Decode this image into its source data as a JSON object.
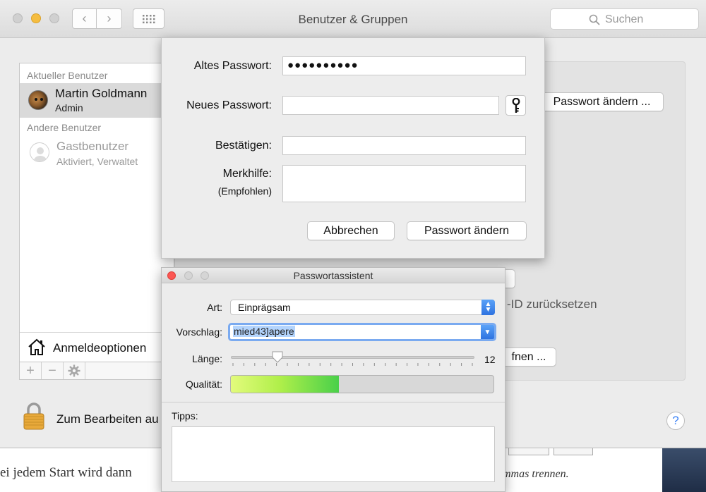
{
  "window": {
    "title": "Benutzer & Gruppen",
    "search_placeholder": "Suchen"
  },
  "sidebar": {
    "current_section": "Aktueller Benutzer",
    "current_user": {
      "name": "Martin Goldmann",
      "role": "Admin"
    },
    "other_section": "Andere Benutzer",
    "guest_user": {
      "name": "Gastbenutzer",
      "status": "Aktiviert, Verwaltet"
    },
    "login_options": "Anmeldeoptionen",
    "toolbar": {
      "add": "+",
      "remove": "−"
    }
  },
  "background_panel": {
    "change_password_button": "Passwort ändern ...",
    "reset_text": "-ID zurücksetzen",
    "open_button": "fnen ..."
  },
  "lock": {
    "label": "Zum Bearbeiten au"
  },
  "help": {
    "label": "?"
  },
  "background_doc": {
    "left_text": "ei jedem Start wird dann",
    "right_text": "ommas trennen."
  },
  "password_sheet": {
    "old_label": "Altes Passwort:",
    "old_value": "●●●●●●●●●●",
    "new_label": "Neues Passwort:",
    "new_value": "",
    "confirm_label": "Bestätigen:",
    "confirm_value": "",
    "hint_label": "Merkhilfe:",
    "hint_sublabel": "(Empfohlen)",
    "hint_value": "",
    "cancel_button": "Abbrechen",
    "submit_button": "Passwort ändern"
  },
  "assistant": {
    "title": "Passwortassistent",
    "type_label": "Art:",
    "type_value": "Einprägsam",
    "suggestion_label": "Vorschlag:",
    "suggestion_value": "mied43]apere",
    "length_label": "Länge:",
    "length_value": "12",
    "length_fraction": 0.19,
    "quality_label": "Qualität:",
    "quality_fraction": 0.41,
    "tips_label": "Tipps:",
    "tips_value": ""
  },
  "colors": {
    "accent": "#2e73e0",
    "close_red": "#fc5753",
    "minimize_yellow": "#f5bd40"
  }
}
